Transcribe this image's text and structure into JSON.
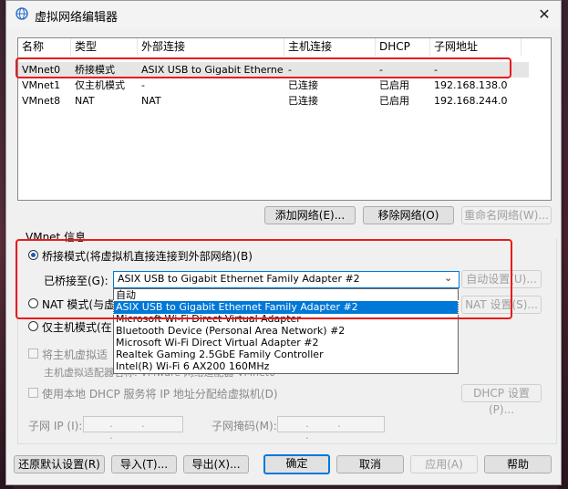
{
  "window": {
    "title": "虚拟网络编辑器",
    "close_glyph": "✕"
  },
  "list": {
    "columns": [
      "名称",
      "类型",
      "外部连接",
      "主机连接",
      "DHCP",
      "子网地址"
    ],
    "rows": [
      [
        "VMnet0",
        "桥接模式",
        "ASIX USB to Gigabit Etherne...",
        "-",
        "-",
        "-"
      ],
      [
        "VMnet1",
        "仅主机模式",
        "-",
        "已连接",
        "已启用",
        "192.168.138.0"
      ],
      [
        "VMnet8",
        "NAT",
        "NAT",
        "已连接",
        "已启用",
        "192.168.244.0"
      ]
    ]
  },
  "list_buttons": {
    "add": "添加网络(E)...",
    "remove": "移除网络(O)",
    "rename": "重命名网络(W)..."
  },
  "vminfo": {
    "legend": "VMnet 信息",
    "bridge_radio": "桥接模式(将虚拟机直接连接到外部网络)(B)",
    "bridged_to_label": "已桥接至(G):",
    "bridged_to_value": "ASIX USB to Gigabit Ethernet Family Adapter #2",
    "dropdown_arrow": "⌄",
    "auto_settings": "自动设置(U)...",
    "nat_radio": "NAT 模式(与虚",
    "nat_settings": "NAT 设置(S)...",
    "host_only_radio": "仅主机模式(在",
    "connect_host_adapter": "将主机虚拟适",
    "host_adapter_name": "主机虚拟适配器名称: VMware 网络适配器 VMnet0",
    "use_dhcp": "使用本地 DHCP 服务将 IP 地址分配给虚拟机(D)",
    "dhcp_settings": "DHCP 设置(P)...",
    "subnet_ip_label": "子网 IP (I):",
    "subnet_ip_value": ". . .",
    "subnet_mask_label": "子网掩码(M):",
    "subnet_mask_value": ". . ."
  },
  "dropdown_options": [
    "自动",
    "ASIX USB to Gigabit Ethernet Family Adapter #2",
    "Microsoft Wi-Fi Direct Virtual Adapter",
    "Bluetooth Device (Personal Area Network) #2",
    "Microsoft Wi-Fi Direct Virtual Adapter #2",
    "Realtek Gaming 2.5GbE Family Controller",
    "Intel(R) Wi-Fi 6 AX200 160MHz"
  ],
  "footer_buttons": {
    "restore": "还原默认设置(R)",
    "import": "导入(T)...",
    "export": "导出(X)...",
    "ok": "确定",
    "cancel": "取消",
    "apply": "应用(A)",
    "help": "帮助"
  },
  "colors": {
    "highlight": "#0078d7",
    "annotation_red": "#e81b1b"
  }
}
